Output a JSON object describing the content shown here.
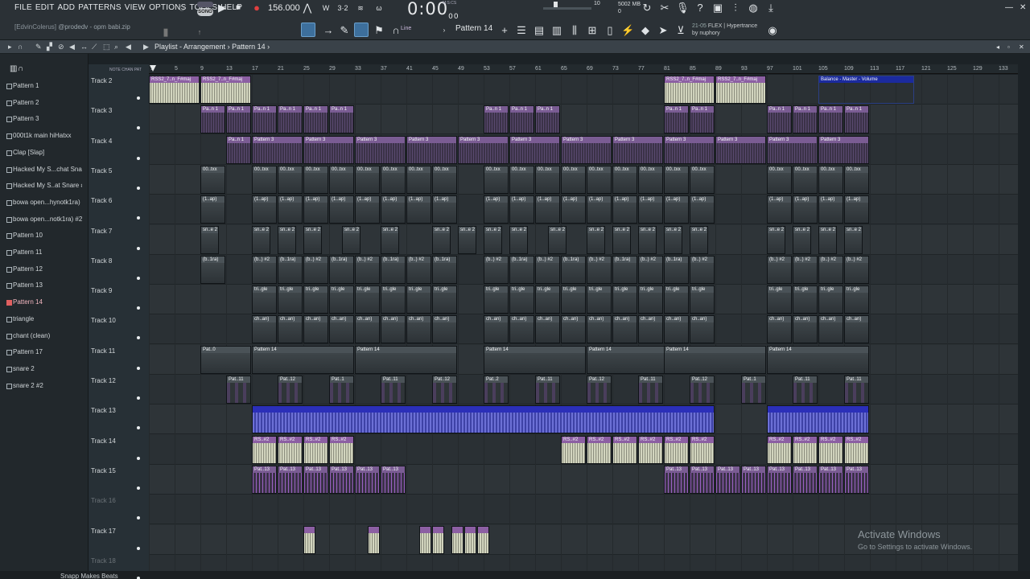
{
  "menu": [
    "FILE",
    "EDIT",
    "ADD",
    "PATTERNS",
    "VIEW",
    "OPTIONS",
    "TOOLS",
    "HELP"
  ],
  "transport": {
    "mode": "SONG",
    "tempo": "156.000",
    "time": "0:00",
    "time_sub": "00",
    "time_unit": "M:S:CS"
  },
  "system": {
    "cpu": "10",
    "memory": "5002 MB",
    "mem_sub": "0"
  },
  "hint": {
    "user": "[EdvinColerus]",
    "text": "@prodedv - opm babi.zip"
  },
  "news": {
    "date": "21-05",
    "title": "FLEX | Hypertrance",
    "author": "by nuphory"
  },
  "toolbar": {
    "line_label": "Line",
    "pattern_label": "Pattern 14"
  },
  "playlist": {
    "title": "Playlist - Arrangement",
    "separator": "›",
    "pattern": "Pattern 14"
  },
  "picker": [
    "Pattern 1",
    "Pattern 2",
    "Pattern 3",
    "000t1k main hiHatxx",
    "Clap [Slap]",
    "Hacked My S...chat Snare",
    "Hacked My S..at Snare #2",
    "bowa open...hynotk1ra)",
    "bowa open...notk1ra) #2",
    "Pattern 10",
    "Pattern 11",
    "Pattern 12",
    "Pattern 13",
    "Pattern 14",
    "triangle",
    "chant (clean)",
    "Pattern 17",
    "snare 2",
    "snare 2 #2"
  ],
  "picker_active": "Pattern 14",
  "ruler": [
    "1",
    "5",
    "9",
    "13",
    "17",
    "21",
    "25",
    "29",
    "33",
    "37",
    "41",
    "45",
    "49",
    "53",
    "57",
    "61",
    "65",
    "69",
    "73",
    "77",
    "81",
    "85",
    "89",
    "93",
    "97",
    "101",
    "105",
    "109",
    "113",
    "117",
    "121",
    "125",
    "129",
    "133"
  ],
  "tracks": [
    "Track 2",
    "Track 3",
    "Track 4",
    "Track 5",
    "Track 6",
    "Track 7",
    "Track 8",
    "Track 9",
    "Track 10",
    "Track 11",
    "Track 12",
    "Track 13",
    "Track 14",
    "Track 15",
    "Track 16",
    "Track 17",
    "Track 18"
  ],
  "clip_labels": {
    "rss2": "RSS2_7..n_F#maj",
    "pan": "Pa..n 1",
    "p3": "Pattern 3",
    "hh": "00..txx",
    "clap": "(1..ap)",
    "snare": "sn..e 2",
    "bowa": "(b..1ra)",
    "bowa2": "(b..) #2",
    "tri": "tri..gle",
    "chant": "ch..an)",
    "p14": "Pattern 14",
    "pat0": "Pat..0",
    "pat11": "Pat..11",
    "pat12": "Pat..12",
    "pat1": "Pat..1",
    "pat2": "Pat..2",
    "rs2": "RS..#2",
    "pat13": "Pat..13",
    "auto": "Balance - Master - Volume"
  },
  "watermark": {
    "title": "Activate Windows",
    "subtitle": "Go to Settings to activate Windows."
  },
  "channel_bottom": "Snapp Makes Beats"
}
